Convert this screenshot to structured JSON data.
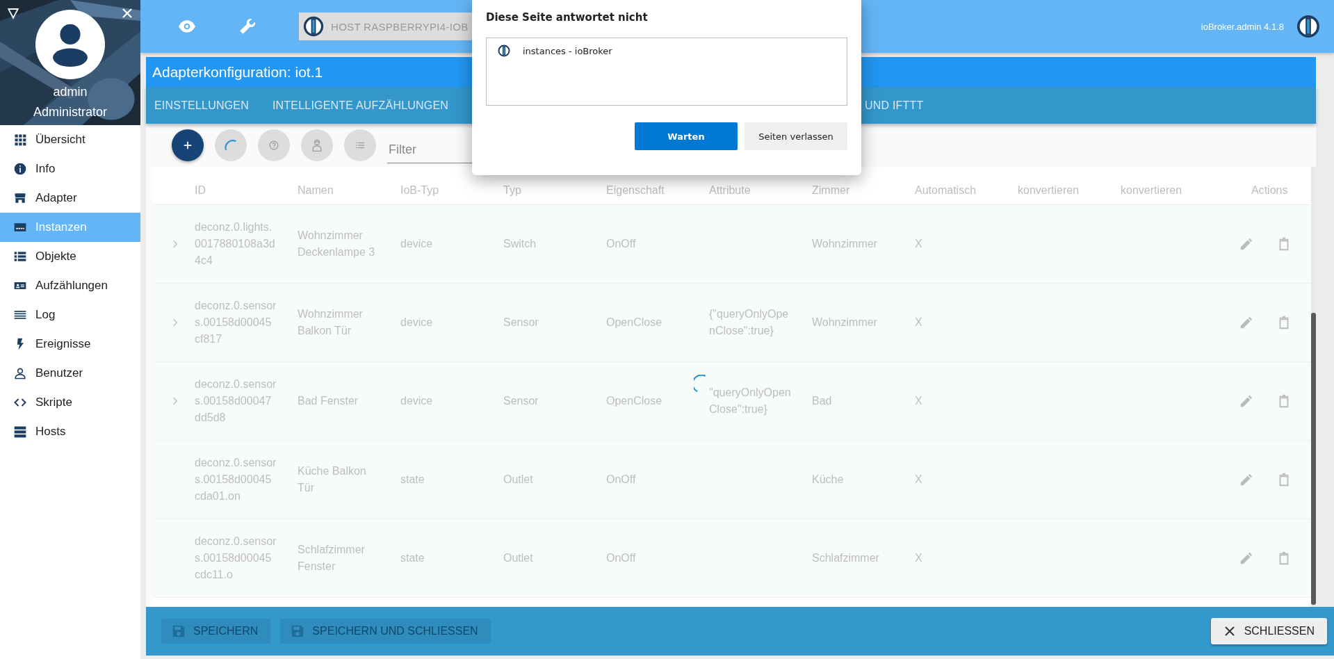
{
  "sidebar": {
    "user": {
      "name": "admin",
      "role": "Administrator"
    },
    "items": [
      {
        "label": "Übersicht",
        "selected": false
      },
      {
        "label": "Info",
        "selected": false
      },
      {
        "label": "Adapter",
        "selected": false
      },
      {
        "label": "Instanzen",
        "selected": true
      },
      {
        "label": "Objekte",
        "selected": false
      },
      {
        "label": "Aufzählungen",
        "selected": false
      },
      {
        "label": "Log",
        "selected": false
      },
      {
        "label": "Ereignisse",
        "selected": false
      },
      {
        "label": "Benutzer",
        "selected": false
      },
      {
        "label": "Skripte",
        "selected": false
      },
      {
        "label": "Hosts",
        "selected": false
      }
    ]
  },
  "top_bar": {
    "host": "HOST RASPBERRYPI4-IOB",
    "version": "ioBroker.admin 4.1.8"
  },
  "adapter": {
    "title": "Adapterkonfiguration: iot.1",
    "tabs": [
      {
        "label": "EINSTELLUNGEN",
        "selected": false
      },
      {
        "label": "INTELLIGENTE AUFZÄHLUNGEN",
        "selected": false
      },
      {
        "label": "UND IFTTT",
        "selected": false
      }
    ]
  },
  "toolbar": {
    "filter": {
      "placeholder": "Filter"
    }
  },
  "table": {
    "columns": [
      "ID",
      "Namen",
      "IoB-Typ",
      "Typ",
      "Eigenschaft",
      "Attribute",
      "Zimmer",
      "Automatisch",
      "konvertieren",
      "konvertieren",
      "Actions"
    ],
    "rows": [
      {
        "expandable": true,
        "loading": false,
        "id": "deconz.0.lights.0017880108a3d4c4",
        "name": "Wohnzimmer Deckenlampe 3",
        "iob_type": "device",
        "type": "Switch",
        "property": "OnOff",
        "room": "Wohnzimmer",
        "auto": "X"
      },
      {
        "expandable": true,
        "loading": false,
        "id": "deconz.0.sensors.00158d00045cf817",
        "name": "Wohnzimmer Balkon Tür",
        "iob_type": "device",
        "type": "Sensor",
        "property": "OpenClose",
        "attributes": "{\"queryOnlyOpenClose\":true}",
        "room": "Wohnzimmer",
        "auto": "X"
      },
      {
        "expandable": true,
        "loading": true,
        "id": "deconz.0.sensors.00158d00047dd5d8",
        "name": "Bad Fenster",
        "iob_type": "device",
        "type": "Sensor",
        "property": "OpenClose",
        "attributes": "\"queryOnlyOpenClose\":true}",
        "room": "Bad",
        "auto": "X"
      },
      {
        "expandable": false,
        "loading": false,
        "id": "deconz.0.sensors.00158d00045cda01.on",
        "name": "Küche Balkon Tür",
        "iob_type": "state",
        "type": "Outlet",
        "property": "OnOff",
        "room": "Küche",
        "auto": "X"
      },
      {
        "expandable": false,
        "loading": false,
        "id": "deconz.0.sensors.00158d00045cdc11.o",
        "name": "Schlafzimmer Fenster",
        "iob_type": "state",
        "type": "Outlet",
        "property": "OnOff",
        "room": "Schlafzimmer",
        "auto": "X"
      }
    ]
  },
  "bottom_bar": {
    "buttons": [
      {
        "label": "SPEICHERN",
        "disabled": true
      },
      {
        "label": "SPEICHERN UND SCHLIESSEN",
        "disabled": true
      }
    ],
    "close": "SCHLIESSEN"
  },
  "dialog": {
    "title": "Diese Seite antwortet nicht",
    "item": "instances - ioBroker",
    "buttons": [
      {
        "label": "Warten",
        "primary": true
      },
      {
        "label": "Seiten verlassen",
        "primary": false
      }
    ]
  }
}
